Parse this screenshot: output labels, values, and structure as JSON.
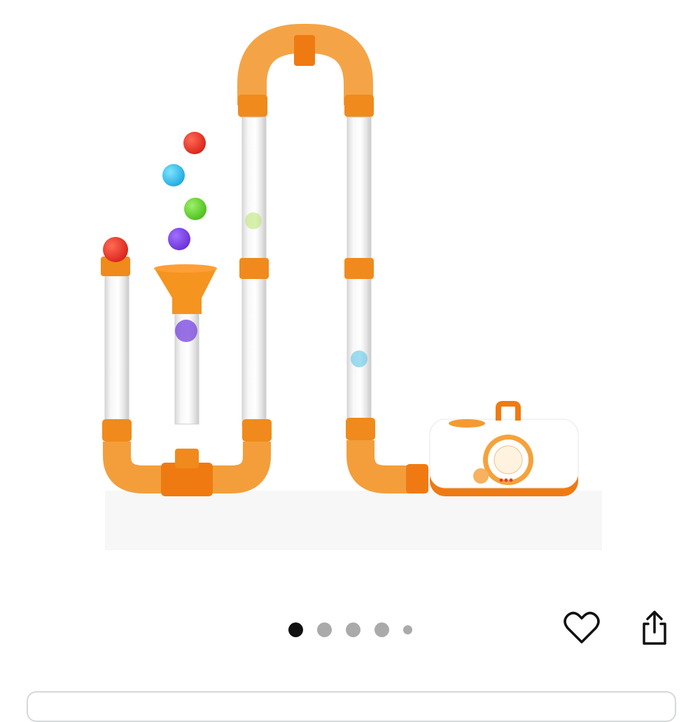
{
  "carousel": {
    "active_index": 0,
    "total_dots": 5
  },
  "actions": {
    "wishlist_icon": "heart-outline-icon",
    "share_icon": "share-icon"
  },
  "colors": {
    "accent_orange": "#f28a1c",
    "dot_active": "#111111",
    "dot_inactive": "#aaaaaa",
    "card_border": "#d5d9d9"
  }
}
